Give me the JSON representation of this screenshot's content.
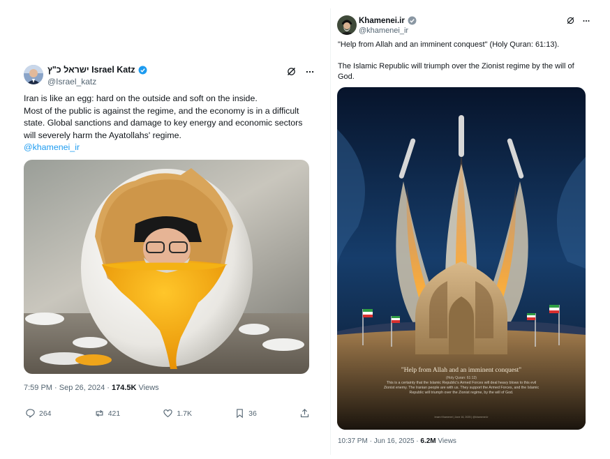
{
  "tweet_left": {
    "author_name": "ישראל כ\"ץ Israel Katz",
    "handle": "@Israel_katz",
    "body_lines": [
      "Iran is like an egg: hard on the outside and soft on the inside.",
      "Most of the public is against the regime, and the economy is in a difficult state. Global sanctions and damage to key energy and economic sectors will severely harm the Ayatollahs' regime."
    ],
    "mention": "@khamenei_ir",
    "timestamp": "7:59 PM · Sep 26, 2024 · ",
    "views_count": "174.5K",
    "views_label": " Views",
    "stats": {
      "replies": "264",
      "reposts": "421",
      "likes": "1.7K",
      "bookmarks": "36"
    },
    "icons": [
      "grok-icon",
      "more-icon",
      "reply-icon",
      "repost-icon",
      "like-icon",
      "bookmark-icon",
      "share-icon",
      "verified-icon"
    ]
  },
  "tweet_right": {
    "author_name": "Khamenei.ir",
    "handle": "@khamenei_ir",
    "quote_line": "\"Help from Allah and an imminent conquest\" (Holy Quran: 61:13).",
    "body_line": "The Islamic Republic will triumph over the Zionist regime by the will of God.",
    "image_caption": {
      "title": "\"Help from Allah and an imminent conquest\"",
      "reference": "(Holy Quran: 61:13)",
      "text": "This is a certainty that the Islamic Republic's Armed Forces will deal heavy blows to this evil Zionist enemy. The Iranian people are with us. They support the Armed Forces, and the Islamic Republic will triumph over the Zionist regime, by the will of God.",
      "footer": "Imam Khamenei | June 16, 2025 | @khamenei.ir"
    },
    "timestamp": "10:37 PM · Jun 16, 2025 · ",
    "views_count": "6.2M",
    "views_label": " Views"
  },
  "colors": {
    "accent": "#1d9bf0",
    "text": "#0f1419",
    "muted": "#536471"
  }
}
